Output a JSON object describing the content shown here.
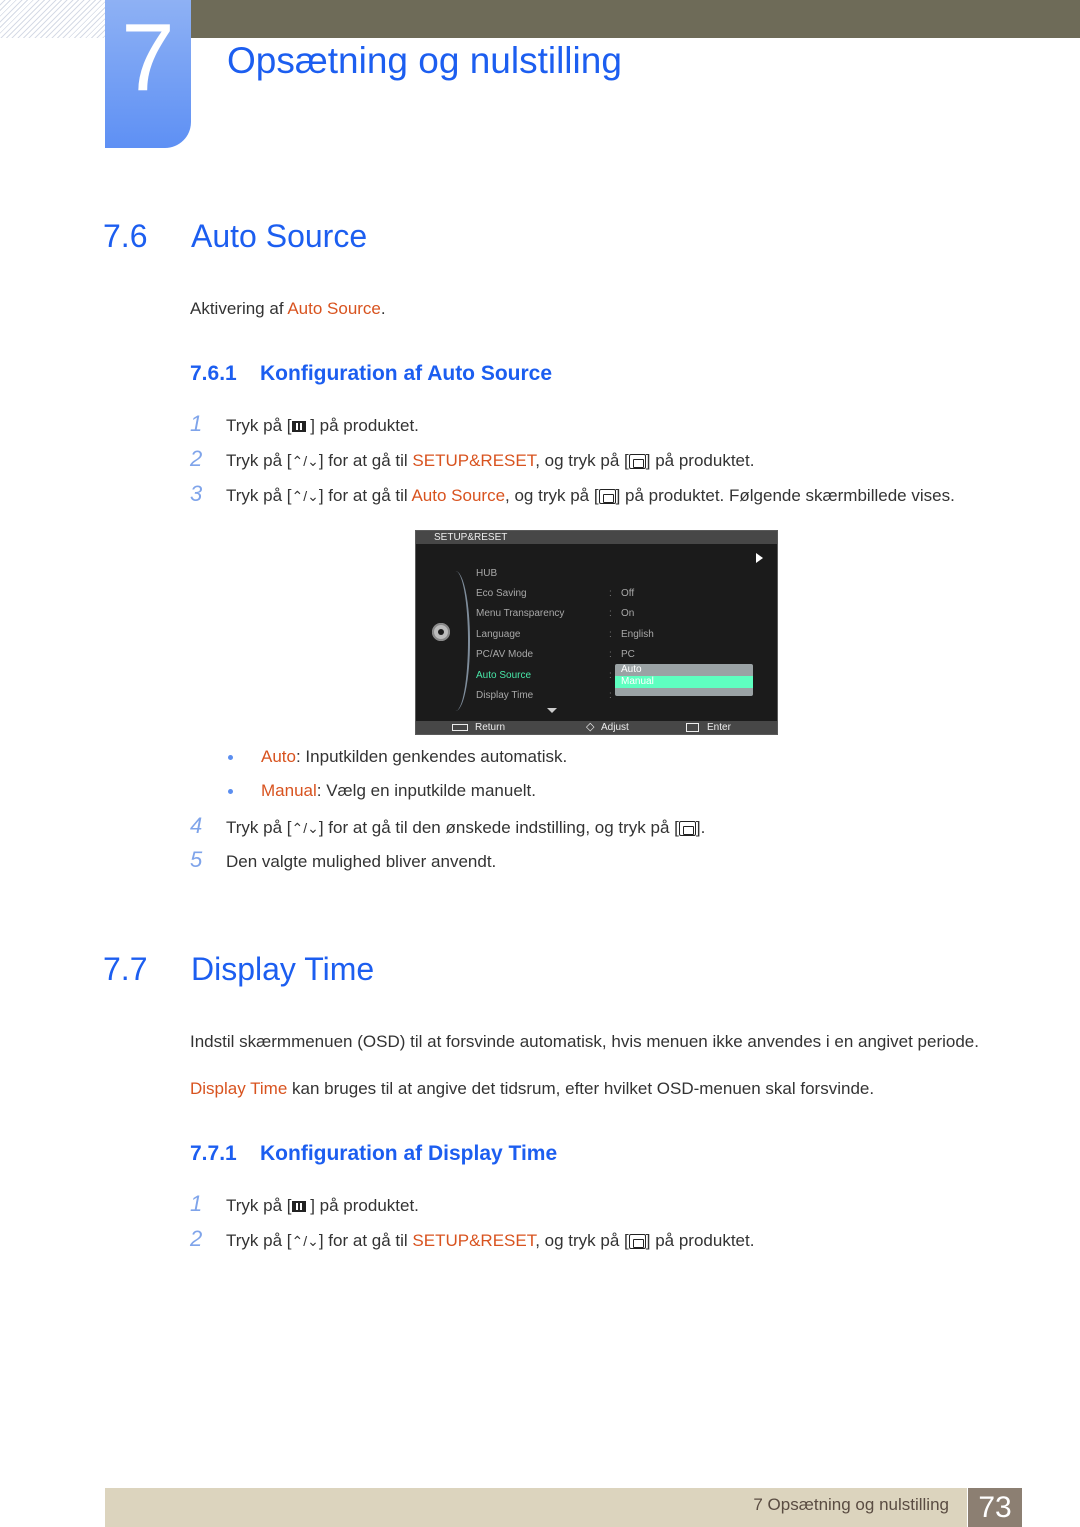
{
  "chapter": {
    "number": "7",
    "title": "Opsætning og nulstilling"
  },
  "sections": [
    {
      "number": "7.6",
      "title": "Auto Source",
      "intro_prefix": "Aktivering af ",
      "intro_highlight": "Auto Source",
      "intro_suffix": ".",
      "subsection": {
        "number": "7.6.1",
        "title": "Konfiguration af Auto Source"
      },
      "steps": [
        {
          "n": "1",
          "pre": "Tryk på [",
          "icon": "menu-icon",
          "post": " ] på produktet."
        },
        {
          "n": "2",
          "pre": "Tryk på [",
          "icon": "up-down-icon",
          "mid1": "] for at gå til ",
          "hl": "SETUP&RESET",
          "mid2": ", og tryk på [",
          "icon2": "enter-icon",
          "post": "] på produktet."
        },
        {
          "n": "3",
          "pre": "Tryk på [",
          "icon": "up-down-icon",
          "mid1": "] for at gå til ",
          "hl": "Auto Source",
          "mid2": ", og tryk på [",
          "icon2": "enter-icon",
          "post": "] på produktet. Følgende skærmbillede vises."
        }
      ],
      "osd": {
        "header": "SETUP&RESET",
        "rows": [
          {
            "label": "HUB",
            "value": ""
          },
          {
            "label": "Eco Saving",
            "value": "Off"
          },
          {
            "label": "Menu Transparency",
            "value": "On"
          },
          {
            "label": "Language",
            "value": "English"
          },
          {
            "label": "PC/AV Mode",
            "value": "PC"
          },
          {
            "label": "Auto Source",
            "value": "",
            "active": true
          },
          {
            "label": "Display Time",
            "value": ""
          }
        ],
        "dropdown": [
          "Auto",
          "Manual"
        ],
        "dropdown_selected": "Manual",
        "footer": {
          "return": "Return",
          "adjust": "Adjust",
          "enter": "Enter"
        },
        "colors": {
          "active": "#48e7a8",
          "selected_bg": "#5effc0"
        }
      },
      "bullets": [
        {
          "hl": "Auto",
          "text": ": Inputkilden genkendes automatisk."
        },
        {
          "hl": "Manual",
          "text": ": Vælg en inputkilde manuelt."
        }
      ],
      "steps_after": [
        {
          "n": "4",
          "pre": "Tryk på [",
          "mid1": "] for at gå til den ønskede indstilling, og tryk på [",
          "post": "]."
        },
        {
          "n": "5",
          "text": "Den valgte mulighed bliver anvendt."
        }
      ]
    },
    {
      "number": "7.7",
      "title": "Display Time",
      "para1": "Indstil skærmmenuen (OSD) til at forsvinde automatisk, hvis menuen ikke anvendes i en angivet periode.",
      "para2_highlight": "Display Time",
      "para2_rest": " kan bruges til at angive det tidsrum, efter hvilket OSD-menuen skal forsvinde.",
      "subsection": {
        "number": "7.7.1",
        "title": "Konfiguration af Display Time"
      },
      "steps": [
        {
          "n": "1",
          "pre": "Tryk på [",
          "post": " ] på produktet."
        },
        {
          "n": "2",
          "pre": "Tryk på [",
          "mid1": "] for at gå til ",
          "hl": "SETUP&RESET",
          "mid2": ", og tryk på [",
          "post": "] på produktet."
        }
      ]
    }
  ],
  "footer": {
    "text": "7 Opsætning og nulstilling",
    "page": "73"
  },
  "colors": {
    "heading": "#1c5ef0",
    "highlight": "#d8531f",
    "topbar": "#6e6b58",
    "footer_bg": "#dcd4be",
    "pagebox": "#8c7f72"
  }
}
